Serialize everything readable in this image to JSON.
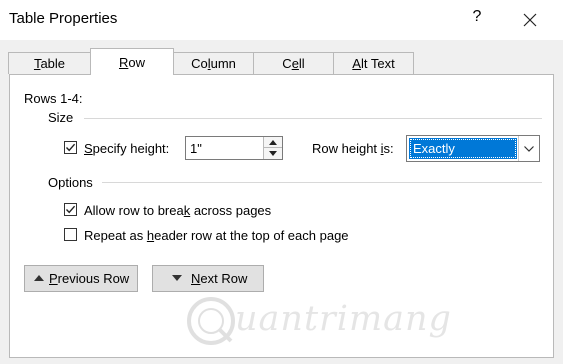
{
  "window": {
    "title": "Table Properties",
    "help": "?"
  },
  "tabs": [
    {
      "pre": "",
      "key": "T",
      "post": "able"
    },
    {
      "pre": "",
      "key": "R",
      "post": "ow"
    },
    {
      "pre": "Co",
      "key": "l",
      "post": "umn"
    },
    {
      "pre": "C",
      "key": "e",
      "post": "ll"
    },
    {
      "pre": "",
      "key": "A",
      "post": "lt Text"
    }
  ],
  "row": {
    "rows_label": "Rows 1-4:",
    "size_group": "Size",
    "specify_height": {
      "pre": "",
      "key": "S",
      "post": "pecify height:",
      "checked": true
    },
    "height_value": "1\"",
    "row_height_is": {
      "pre": "Row height ",
      "key": "i",
      "post": "s:"
    },
    "row_height_mode": "Exactly",
    "options_group": "Options",
    "allow_break": {
      "pre": "Allow row to brea",
      "key": "k",
      "post": " across pages",
      "checked": true
    },
    "repeat_header": {
      "pre": "Repeat as ",
      "key": "h",
      "post": "eader row at the top of each page",
      "checked": false
    },
    "previous_row": {
      "key": "P",
      "post": "revious Row"
    },
    "next_row": {
      "key": "N",
      "post": "ext Row"
    }
  },
  "watermark": "uantrimang",
  "icons": {
    "close": "close-icon",
    "spin_up": "spin-up-arrow-icon",
    "spin_down": "spin-down-arrow-icon",
    "dropdown": "chevron-down-icon",
    "previous": "triangle-up-icon",
    "next": "triangle-down-icon",
    "checkmark": "checkmark-icon"
  },
  "colors": {
    "selection": "#0078d7",
    "dialog_bg": "#f0f0f0",
    "panel_bg": "#ffffff"
  }
}
